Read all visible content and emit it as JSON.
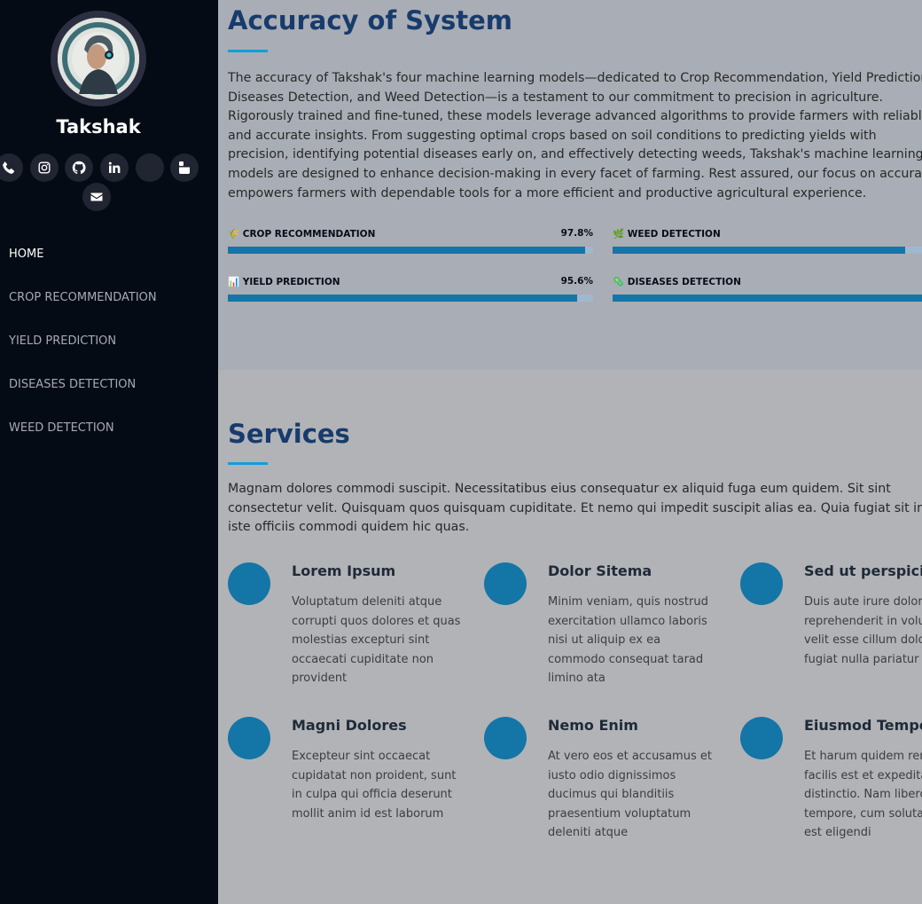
{
  "sidebar": {
    "brand": "Takshak",
    "social": [
      "phone-icon",
      "instagram-icon",
      "github-icon",
      "linkedin-icon",
      "blank-icon",
      "youtube-icon",
      "email-icon"
    ],
    "nav": [
      "HOME",
      "CROP RECOMMENDATION",
      "YIELD PREDICTION",
      "DISEASES DETECTION",
      "WEED DETECTION"
    ],
    "active_index": 0
  },
  "accuracy": {
    "title": "Accuracy of System",
    "text": "The accuracy of Takshak's four machine learning models—dedicated to Crop Recommendation, Yield Prediction, Diseases Detection, and Weed Detection—is a testament to our commitment to precision in agriculture. Rigorously trained and fine-tuned, these models leverage advanced algorithms to provide farmers with reliable and accurate insights. From suggesting optimal crops based on soil conditions to predicting yields with precision, identifying potential diseases early on, and effectively detecting weeds, Takshak's machine learning models are designed to enhance decision-making in every facet of farming. Rest assured, our focus on accuracy empowers farmers with dependable tools for a more efficient and productive agricultural experience.",
    "skills": [
      {
        "emoji": "🌾",
        "label": "CROP RECOMMENDATION",
        "value": "97.8%",
        "percent": 97.8
      },
      {
        "emoji": "🌿",
        "label": "WEED DETECTION",
        "value": "",
        "percent": 80
      },
      {
        "emoji": "📊",
        "label": "YIELD PREDICTION",
        "value": "95.6%",
        "percent": 95.6
      },
      {
        "emoji": "🦠",
        "label": "DISEASES DETECTION",
        "value": "",
        "percent": 100
      }
    ]
  },
  "services": {
    "title": "Services",
    "text": "Magnam dolores commodi suscipit. Necessitatibus eius consequatur ex aliquid fuga eum quidem. Sit sint consectetur velit. Quisquam quos quisquam cupiditate. Et nemo qui impedit suscipit alias ea. Quia fugiat sit in iste officiis commodi quidem hic quas.",
    "items": [
      {
        "title": "Lorem Ipsum",
        "desc": "Voluptatum deleniti atque corrupti quos dolores et quas molestias excepturi sint occaecati cupiditate non provident"
      },
      {
        "title": "Dolor Sitema",
        "desc": "Minim veniam, quis nostrud exercitation ullamco laboris nisi ut aliquip ex ea commodo consequat tarad limino ata"
      },
      {
        "title": "Sed ut perspiciatis",
        "desc": "Duis aute irure dolor in reprehenderit in voluptate velit esse cillum dolore eu fugiat nulla pariatur"
      },
      {
        "title": "Magni Dolores",
        "desc": "Excepteur sint occaecat cupidatat non proident, sunt in culpa qui officia deserunt mollit anim id est laborum"
      },
      {
        "title": "Nemo Enim",
        "desc": "At vero eos et accusamus et iusto odio dignissimos ducimus qui blanditiis praesentium voluptatum deleniti atque"
      },
      {
        "title": "Eiusmod Tempor",
        "desc": "Et harum quidem rerum facilis est et expedita distinctio. Nam libero tempore, cum soluta nobis est eligendi"
      }
    ]
  },
  "colors": {
    "sidebar_bg": "#040b14",
    "accent": "#149ddd",
    "bar": "#1475a7",
    "heading": "#173b6c"
  }
}
